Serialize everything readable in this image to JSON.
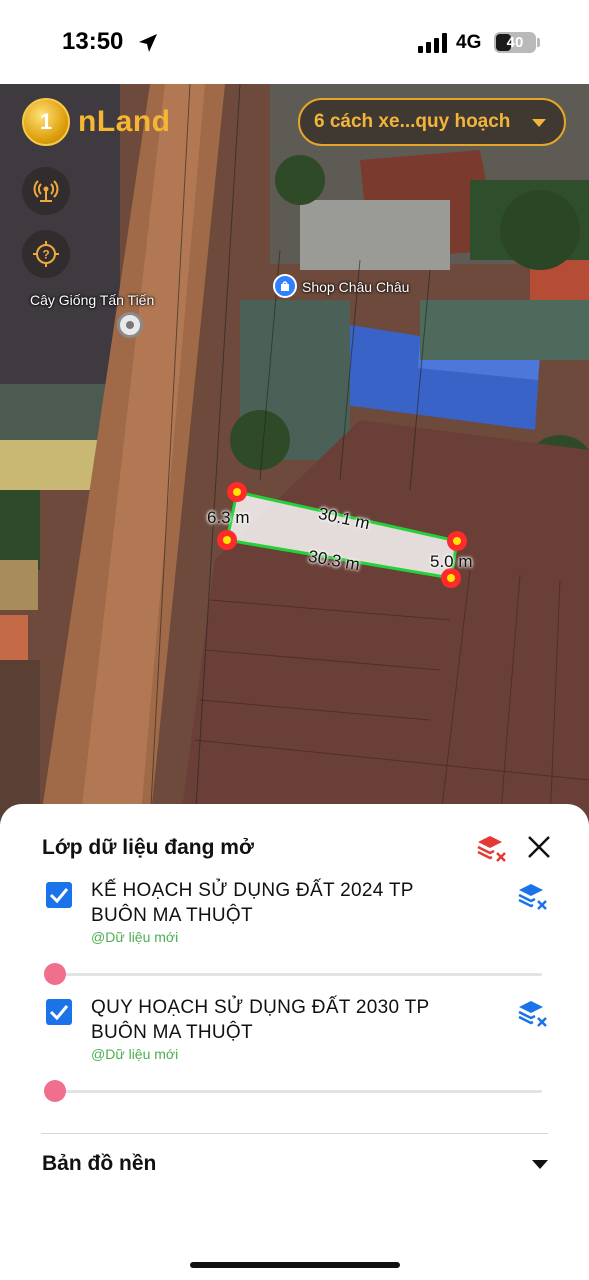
{
  "status_bar": {
    "time": "13:50",
    "network": "4G",
    "battery": "40",
    "battery_level_percent": 40
  },
  "app": {
    "logo_text": "nLand",
    "logo_mark": "1",
    "dropdown_label": "6 cách xe...quy hoạch",
    "accent_color": "#f3b43a"
  },
  "map": {
    "labels": {
      "nursery": "Cây Giống Tấn Tiến",
      "shop": "Shop Châu Châu"
    },
    "measurements": {
      "left_edge": "6.3 m",
      "top_edge": "30.1 m",
      "bottom_edge": "30.3 m",
      "right_edge": "5.0 m"
    },
    "polygon_color": "#2ecc40",
    "vertex_color": "#ff2a2a"
  },
  "sheet": {
    "title": "Lớp dữ liệu đang mở",
    "layers": [
      {
        "name": "KẾ HOẠCH SỬ DỤNG ĐẤT 2024 TP BUÔN MA THUỘT",
        "source": "@Dữ liệu mới",
        "checked": true,
        "opacity_percent": 0
      },
      {
        "name": "QUY HOẠCH SỬ DỤNG ĐẤT 2030 TP BUÔN MA THUỘT",
        "source": "@Dữ liệu mới",
        "checked": true,
        "opacity_percent": 0
      }
    ],
    "basemap_label": "Bản đồ nền",
    "checkbox_color": "#1a73e8",
    "slider_color": "#ef6f8c"
  }
}
